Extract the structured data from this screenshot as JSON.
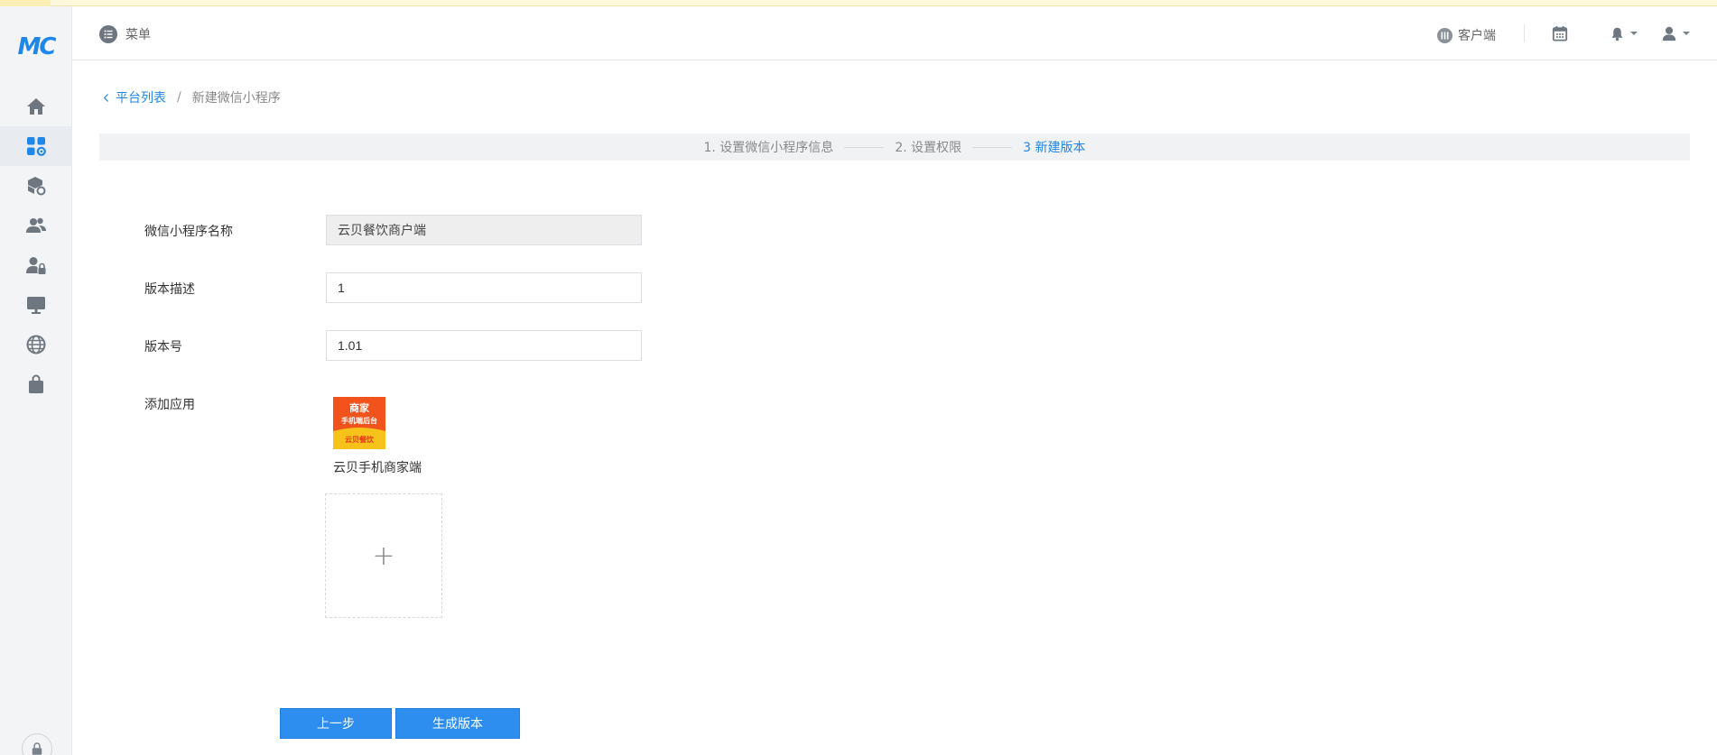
{
  "brand": {
    "logo_text": "MC",
    "accent": "#1f86ea"
  },
  "header": {
    "menu_label": "菜单",
    "client_label": "客户端"
  },
  "breadcrumb": {
    "back_label": "平台列表",
    "separator": "/",
    "current": "新建微信小程序"
  },
  "steps": [
    {
      "label": "1. 设置微信小程序信息",
      "active": false
    },
    {
      "label": "2. 设置权限",
      "active": false
    },
    {
      "label": "3 新建版本",
      "active": true
    }
  ],
  "form": {
    "name_label": "微信小程序名称",
    "name_value": "云贝餐饮商户端",
    "desc_label": "版本描述",
    "desc_value": "1",
    "version_label": "版本号",
    "version_value": "1.01",
    "apps_label": "添加应用",
    "app": {
      "name": "云贝手机商家端",
      "tile_lines": [
        "商家",
        "手机端后台",
        "云贝餐饮"
      ]
    },
    "add_symbol": "+"
  },
  "buttons": {
    "prev_label": "上一步",
    "generate_label": "生成版本"
  },
  "sidebar_icons": [
    "home-icon",
    "apps-settings-icon",
    "package-settings-icon",
    "users-icon",
    "user-lock-icon",
    "monitor-icon",
    "globe-icon",
    "shopping-bag-icon"
  ]
}
